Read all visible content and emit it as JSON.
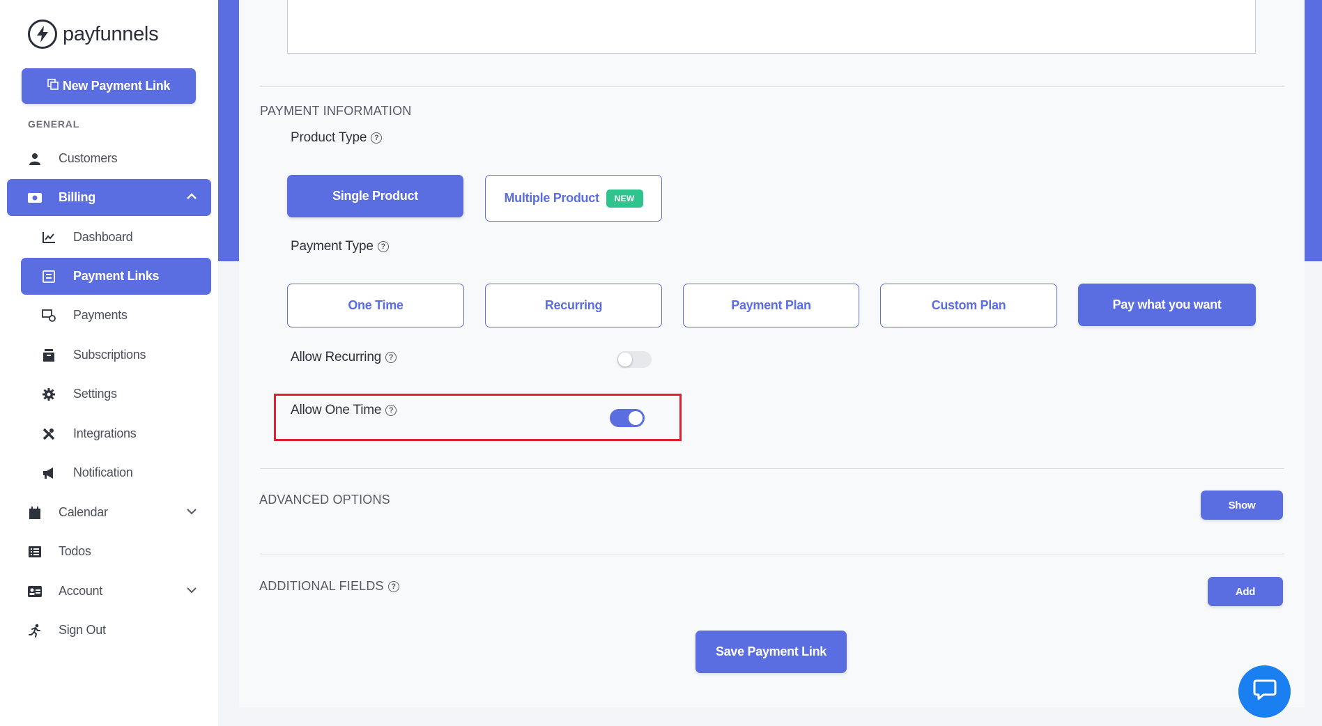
{
  "brand": {
    "name": "payfunnels"
  },
  "sidebar": {
    "new_link_label": "New Payment Link",
    "section_general": "GENERAL",
    "items": {
      "customers": "Customers",
      "billing": "Billing",
      "dashboard": "Dashboard",
      "payment_links": "Payment Links",
      "payments": "Payments",
      "subscriptions": "Subscriptions",
      "settings": "Settings",
      "integrations": "Integrations",
      "notification": "Notification",
      "calendar": "Calendar",
      "todos": "Todos",
      "account": "Account",
      "sign_out": "Sign Out"
    }
  },
  "payment_info": {
    "heading": "PAYMENT INFORMATION",
    "product_type_label": "Product Type",
    "product_types": {
      "single": "Single Product",
      "multiple": "Multiple Product",
      "new_badge": "NEW"
    },
    "payment_type_label": "Payment Type",
    "payment_types": {
      "one_time": "One Time",
      "recurring": "Recurring",
      "payment_plan": "Payment Plan",
      "custom_plan": "Custom Plan",
      "pay_what_you_want": "Pay what you want"
    },
    "allow_recurring_label": "Allow Recurring",
    "allow_one_time_label": "Allow One Time"
  },
  "advanced": {
    "heading": "ADVANCED OPTIONS",
    "show_label": "Show"
  },
  "additional": {
    "heading": "ADDITIONAL FIELDS",
    "add_label": "Add"
  },
  "save_label": "Save Payment Link",
  "toggles": {
    "allow_recurring": false,
    "allow_one_time": true
  },
  "colors": {
    "accent": "#5b6ee1",
    "badge": "#2fc48d",
    "highlight": "#e0202e",
    "chat": "#1a7ff0"
  }
}
